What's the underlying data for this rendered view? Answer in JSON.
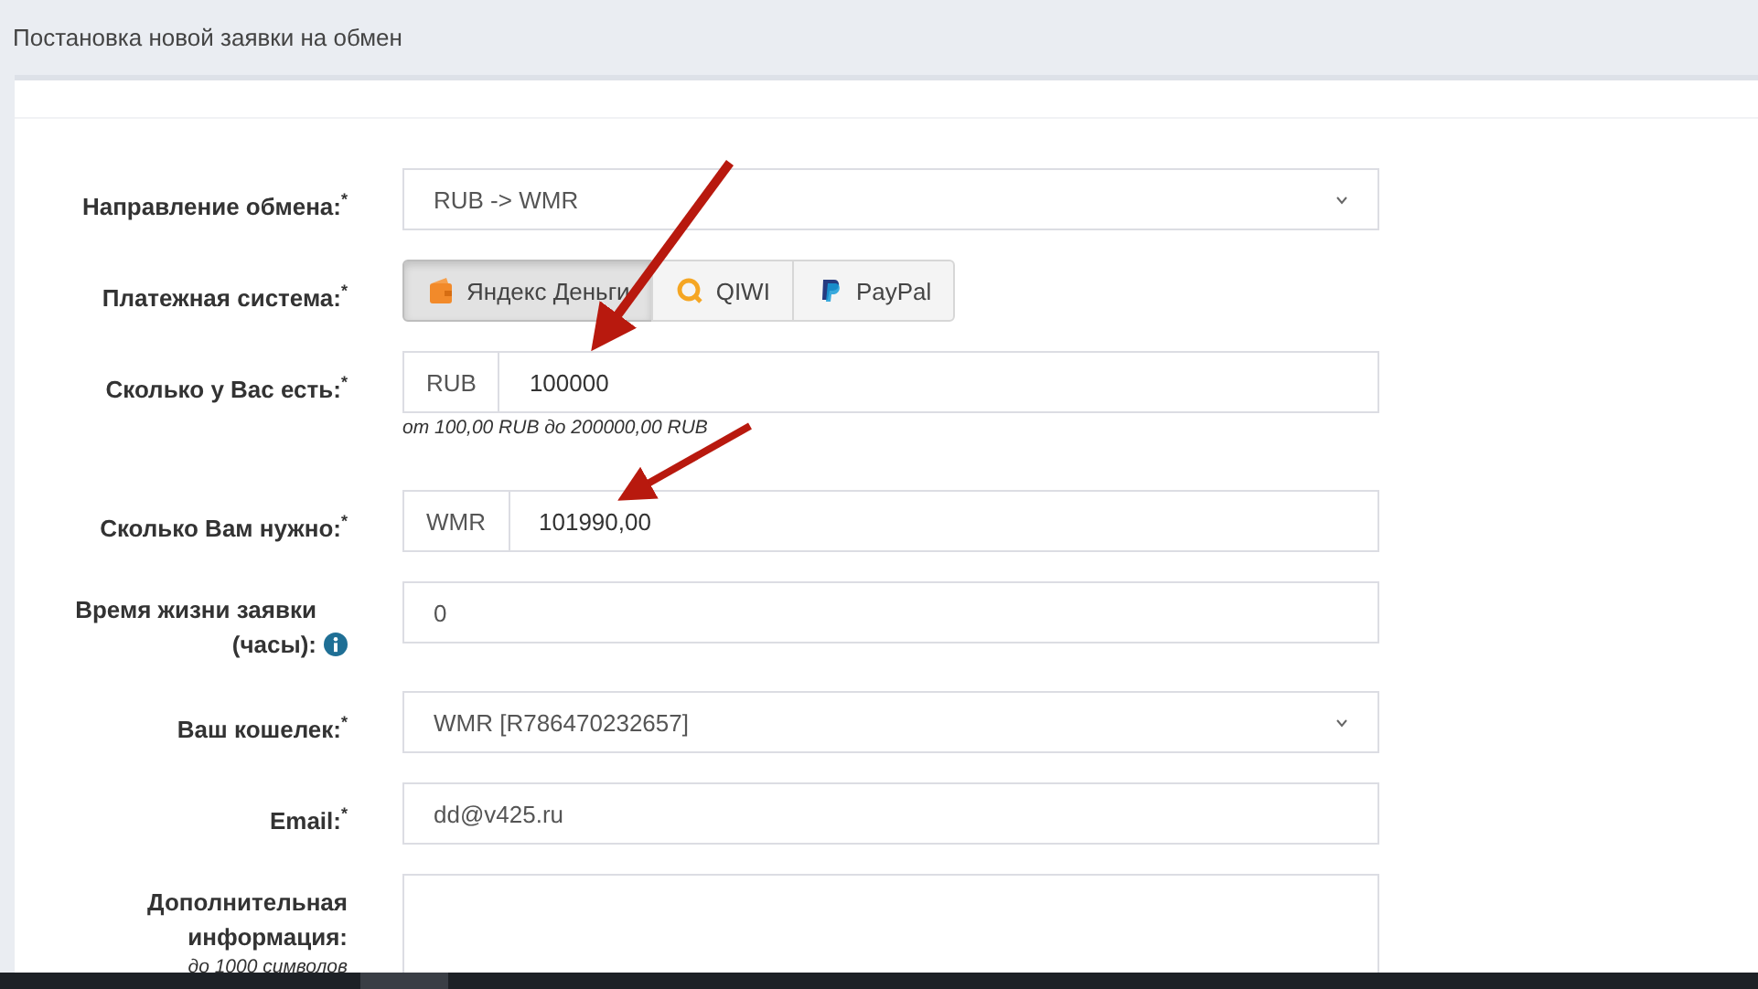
{
  "page_title": "Постановка новой заявки на обмен",
  "fields": [
    {
      "kind": "select",
      "label": "Направление обмена:$^{*}$",
      "value": "RUB -> WMR"
    },
    {
      "kind": "payment",
      "label": "Платежная система:$^{*}$",
      "options": [
        {
          "label": "Яндекс Деньги",
          "selected": true
        },
        {
          "label": "QIWI",
          "selected": false
        },
        {
          "label": "PayPal",
          "selected": false
        }
      ]
    },
    {
      "kind": "amount",
      "label": "Сколько у Вас есть:$^{*}$",
      "currency": "RUB",
      "value": "100000",
      "hint": "от 100,00 RUB до 200000,00 RUB"
    },
    {
      "kind": "amount",
      "label": "Сколько Вам нужно:$^{*}$",
      "currency": "WMR",
      "value": "101990,00"
    },
    {
      "kind": "text",
      "label": "Время жизни заявки (часы):",
      "info": true,
      "value": "0"
    },
    {
      "kind": "select",
      "label": "Ваш кошелек:$^{*}$",
      "value": "WMR [R786470232657]"
    },
    {
      "kind": "text",
      "label": "Email:$^{*}$",
      "value": "dd@v425.ru"
    },
    {
      "kind": "textarea",
      "label": "Дополнительная информация:",
      "hint": "до 1000 символов"
    }
  ]
}
